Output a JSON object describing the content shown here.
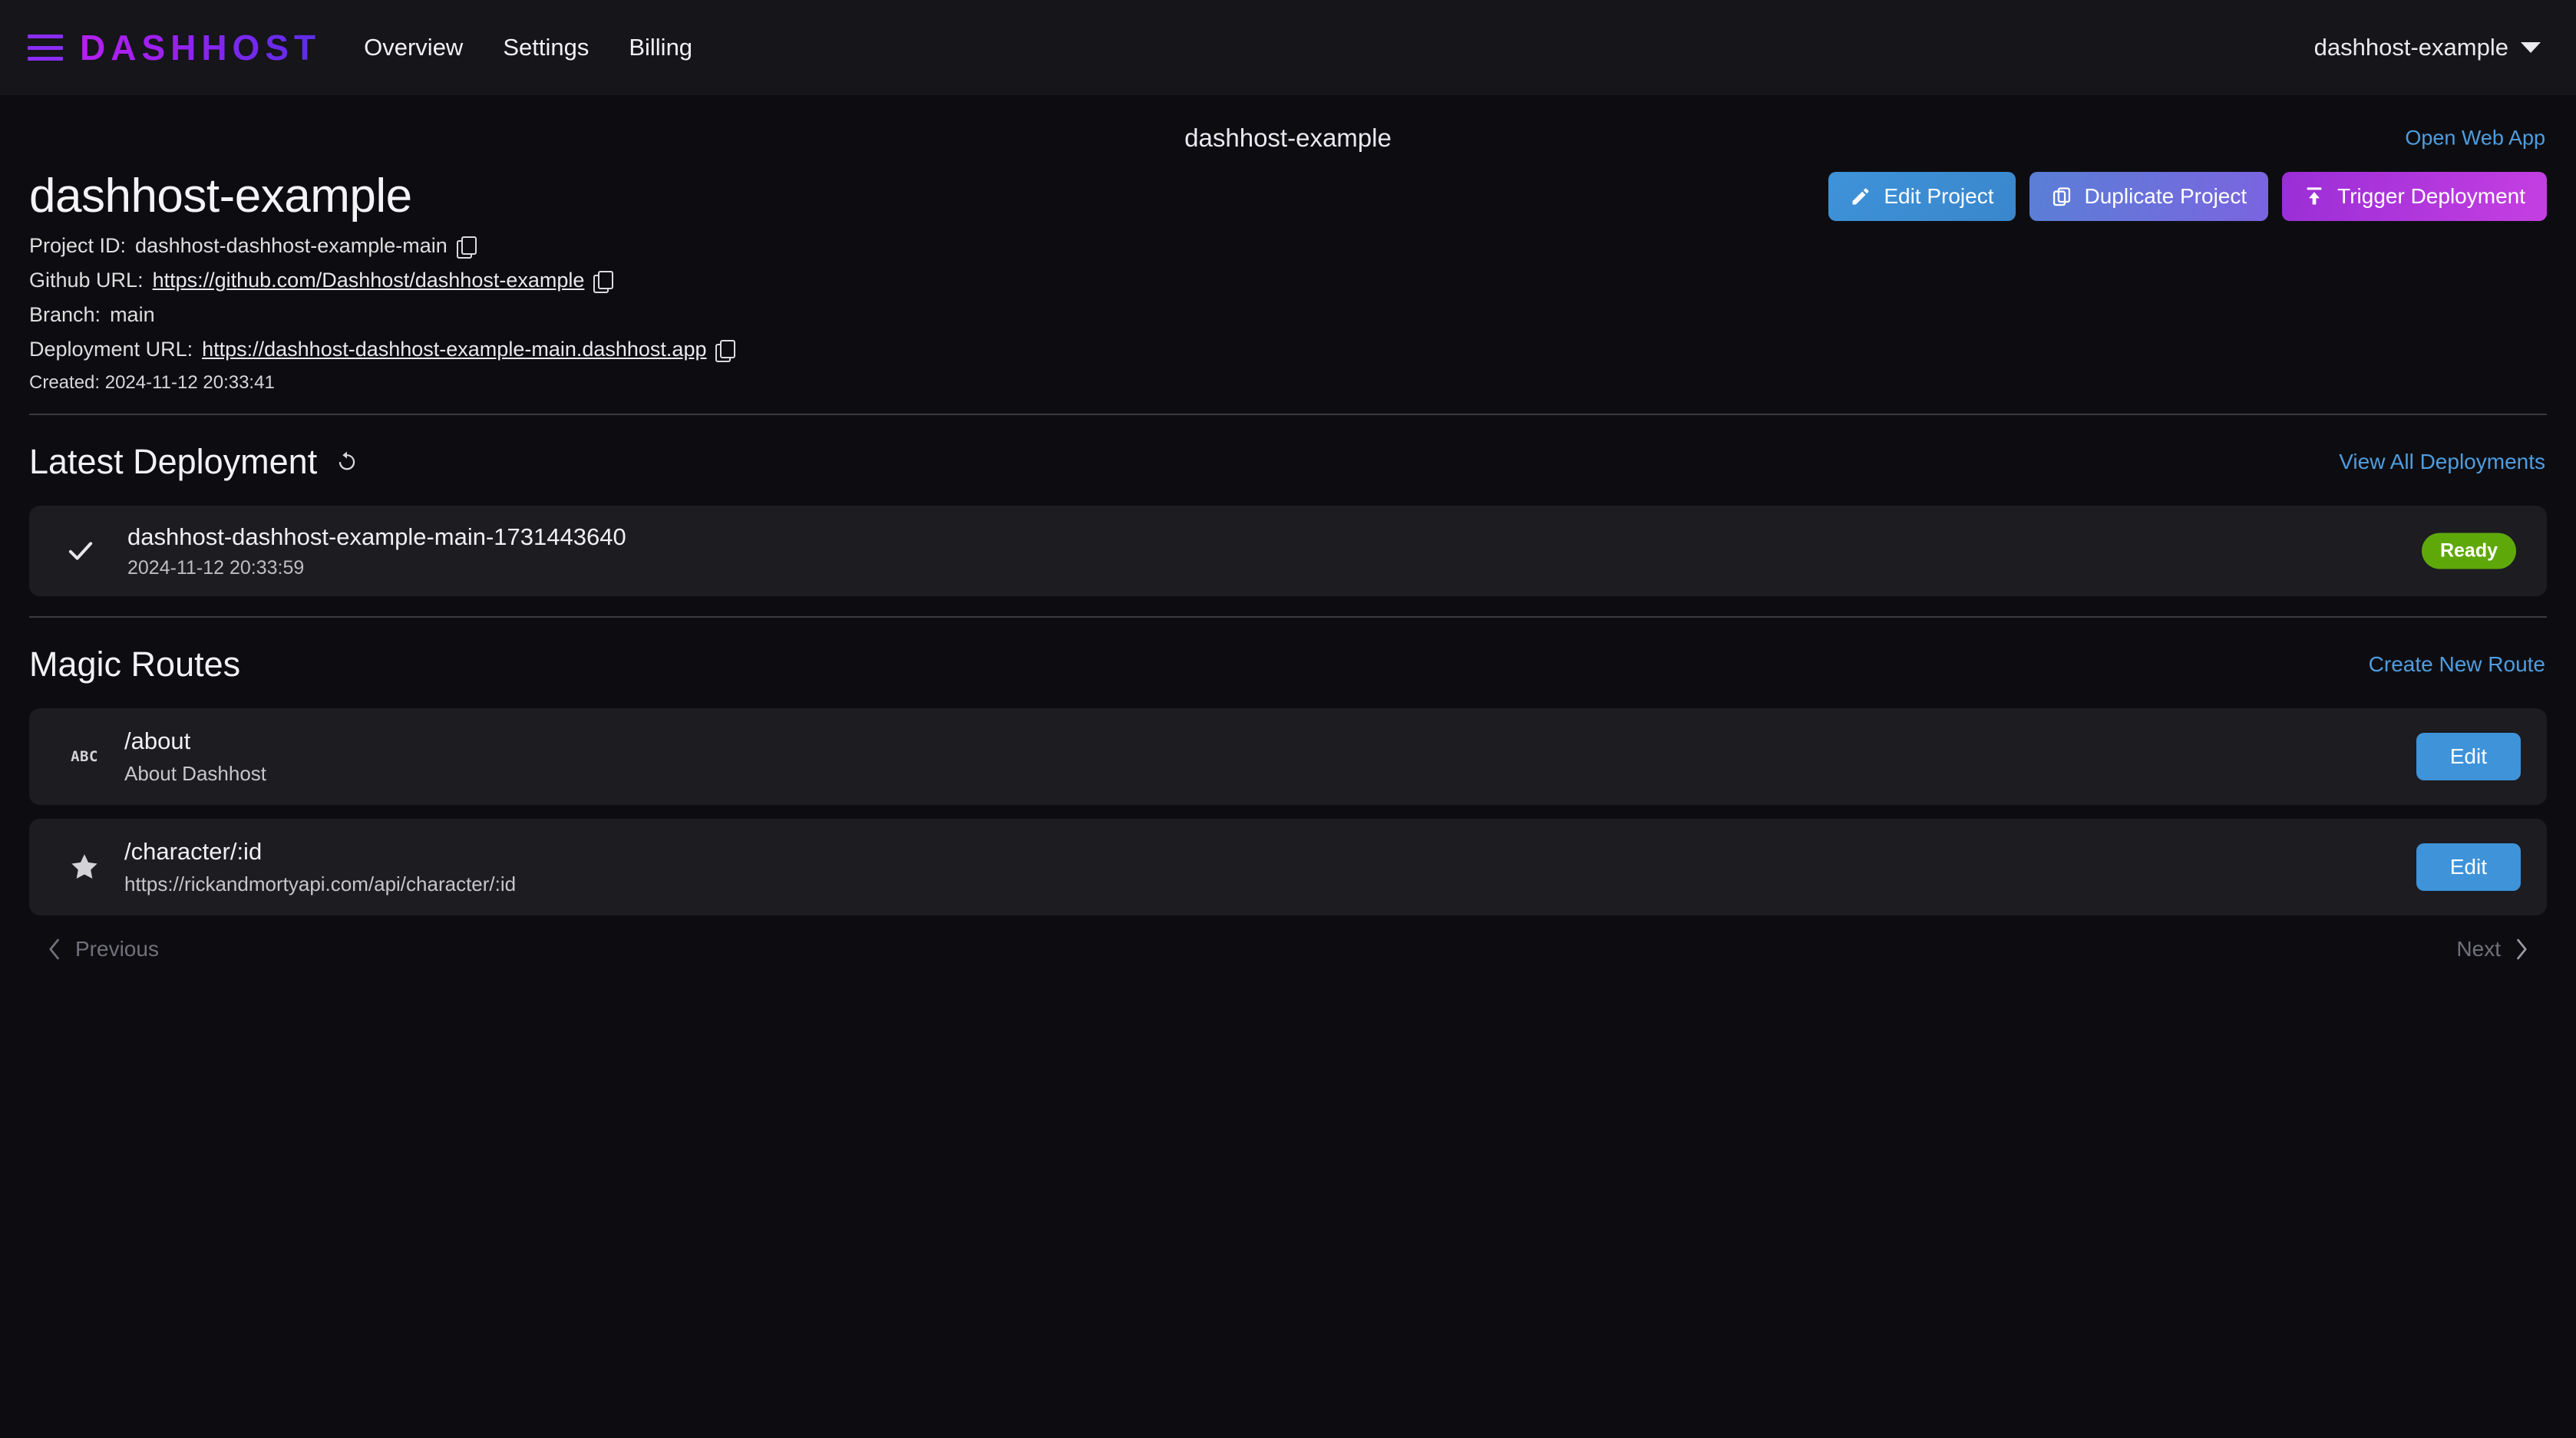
{
  "navbar": {
    "menu_icon": "hamburger-menu-icon",
    "brand": "DASHHOST",
    "links": [
      {
        "label": "Overview"
      },
      {
        "label": "Settings"
      },
      {
        "label": "Billing"
      }
    ],
    "account": {
      "name": "dashhost-example",
      "caret_icon": "chevron-down-icon"
    }
  },
  "subbar": {
    "title": "dashhost-example",
    "open_web_app": "Open Web App"
  },
  "project": {
    "title": "dashhost-example",
    "meta": {
      "project_id_label": "Project ID:",
      "project_id_value": "dashhost-dashhost-example-main",
      "github_label": "Github URL:",
      "github_value": "https://github.com/Dashhost/dashhost-example",
      "branch_label": "Branch:",
      "branch_value": "main",
      "deployment_label": "Deployment URL:",
      "deployment_value": "https://dashhost-dashhost-example-main.dashhost.app",
      "created": "Created: 2024-11-12 20:33:41"
    },
    "actions": [
      {
        "label": "Edit Project",
        "icon": "pencil-icon"
      },
      {
        "label": "Duplicate Project",
        "icon": "copy-icon"
      },
      {
        "label": "Trigger Deployment",
        "icon": "upload-icon"
      }
    ]
  },
  "latest_deployment": {
    "section_title": "Latest Deployment",
    "refresh_icon": "refresh-icon",
    "view_all_label": "View All Deployments",
    "item": {
      "status_icon": "check-icon",
      "name": "dashhost-dashhost-example-main-1731443640",
      "date": "2024-11-12 20:33:59",
      "badge": "Ready"
    }
  },
  "magic_routes": {
    "section_title": "Magic Routes",
    "create_label": "Create New Route",
    "routes": [
      {
        "icon": "abc-text-icon",
        "icon_text": "ABC",
        "path": "/about",
        "sub": "About Dashhost",
        "edit_label": "Edit"
      },
      {
        "icon": "star-icon",
        "icon_text": "",
        "path": "/character/:id",
        "sub": "https://rickandmortyapi.com/api/character/:id",
        "edit_label": "Edit"
      }
    ],
    "pagination": {
      "previous": "Previous",
      "next": "Next",
      "prev_icon": "chevron-left-icon",
      "next_icon": "chevron-right-icon"
    }
  },
  "colors": {
    "page_bg": "#0d0d11",
    "navbar_bg": "#15151a",
    "card_bg": "#1c1c21",
    "brand_gradient_from": "#b421ef",
    "brand_gradient_to": "#5a2ee8",
    "accent_link": "#4f9de0",
    "status_ready": "#5fa80a",
    "button_blue": "#3e93d9",
    "button_purple": "#7b64e0",
    "button_magenta": "#c53fe2"
  }
}
